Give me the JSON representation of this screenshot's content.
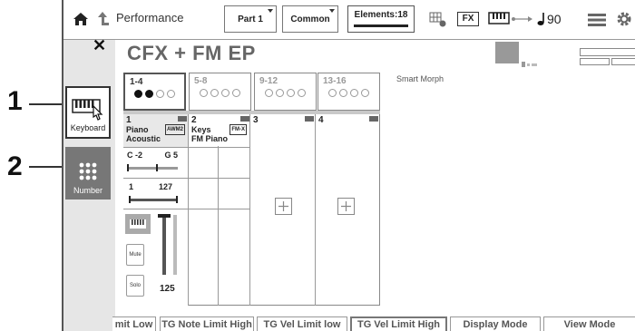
{
  "callouts": [
    "1",
    "2"
  ],
  "topbar": {
    "title": "Performance",
    "part_button": "Part 1",
    "common_button": "Common",
    "elements_label": "Elements:18",
    "fx_label": "FX",
    "tempo_label": "90"
  },
  "sidebar": {
    "close_label": "✕",
    "keyboard_label": "Keyboard",
    "number_label": "Number"
  },
  "performance_name": "CFX + FM EP",
  "part_tabs": [
    {
      "label": "1-4"
    },
    {
      "label": "5-8"
    },
    {
      "label": "9-12"
    },
    {
      "label": "13-16"
    }
  ],
  "smart_morph": "Smart Morph",
  "parts": [
    {
      "number": "1",
      "name": "Piano",
      "sub": "Acoustic",
      "badge": "AWM2"
    },
    {
      "number": "2",
      "name": "Keys",
      "sub": "FM Piano",
      "badge": "FM-X"
    },
    {
      "number": "3"
    },
    {
      "number": "4"
    }
  ],
  "part1": {
    "note_low": "C -2",
    "note_high": "G 5",
    "vel_low": "1",
    "vel_high": "127",
    "mute_label": "Mute",
    "solo_label": "Solo",
    "volume": "125"
  },
  "bottom_tabs": [
    {
      "label": "mit Low"
    },
    {
      "label": "TG Note Limit High"
    },
    {
      "label": "TG Vel Limit low"
    },
    {
      "label": "TG Vel Limit High"
    },
    {
      "label": "Display Mode"
    },
    {
      "label": "View Mode"
    }
  ]
}
